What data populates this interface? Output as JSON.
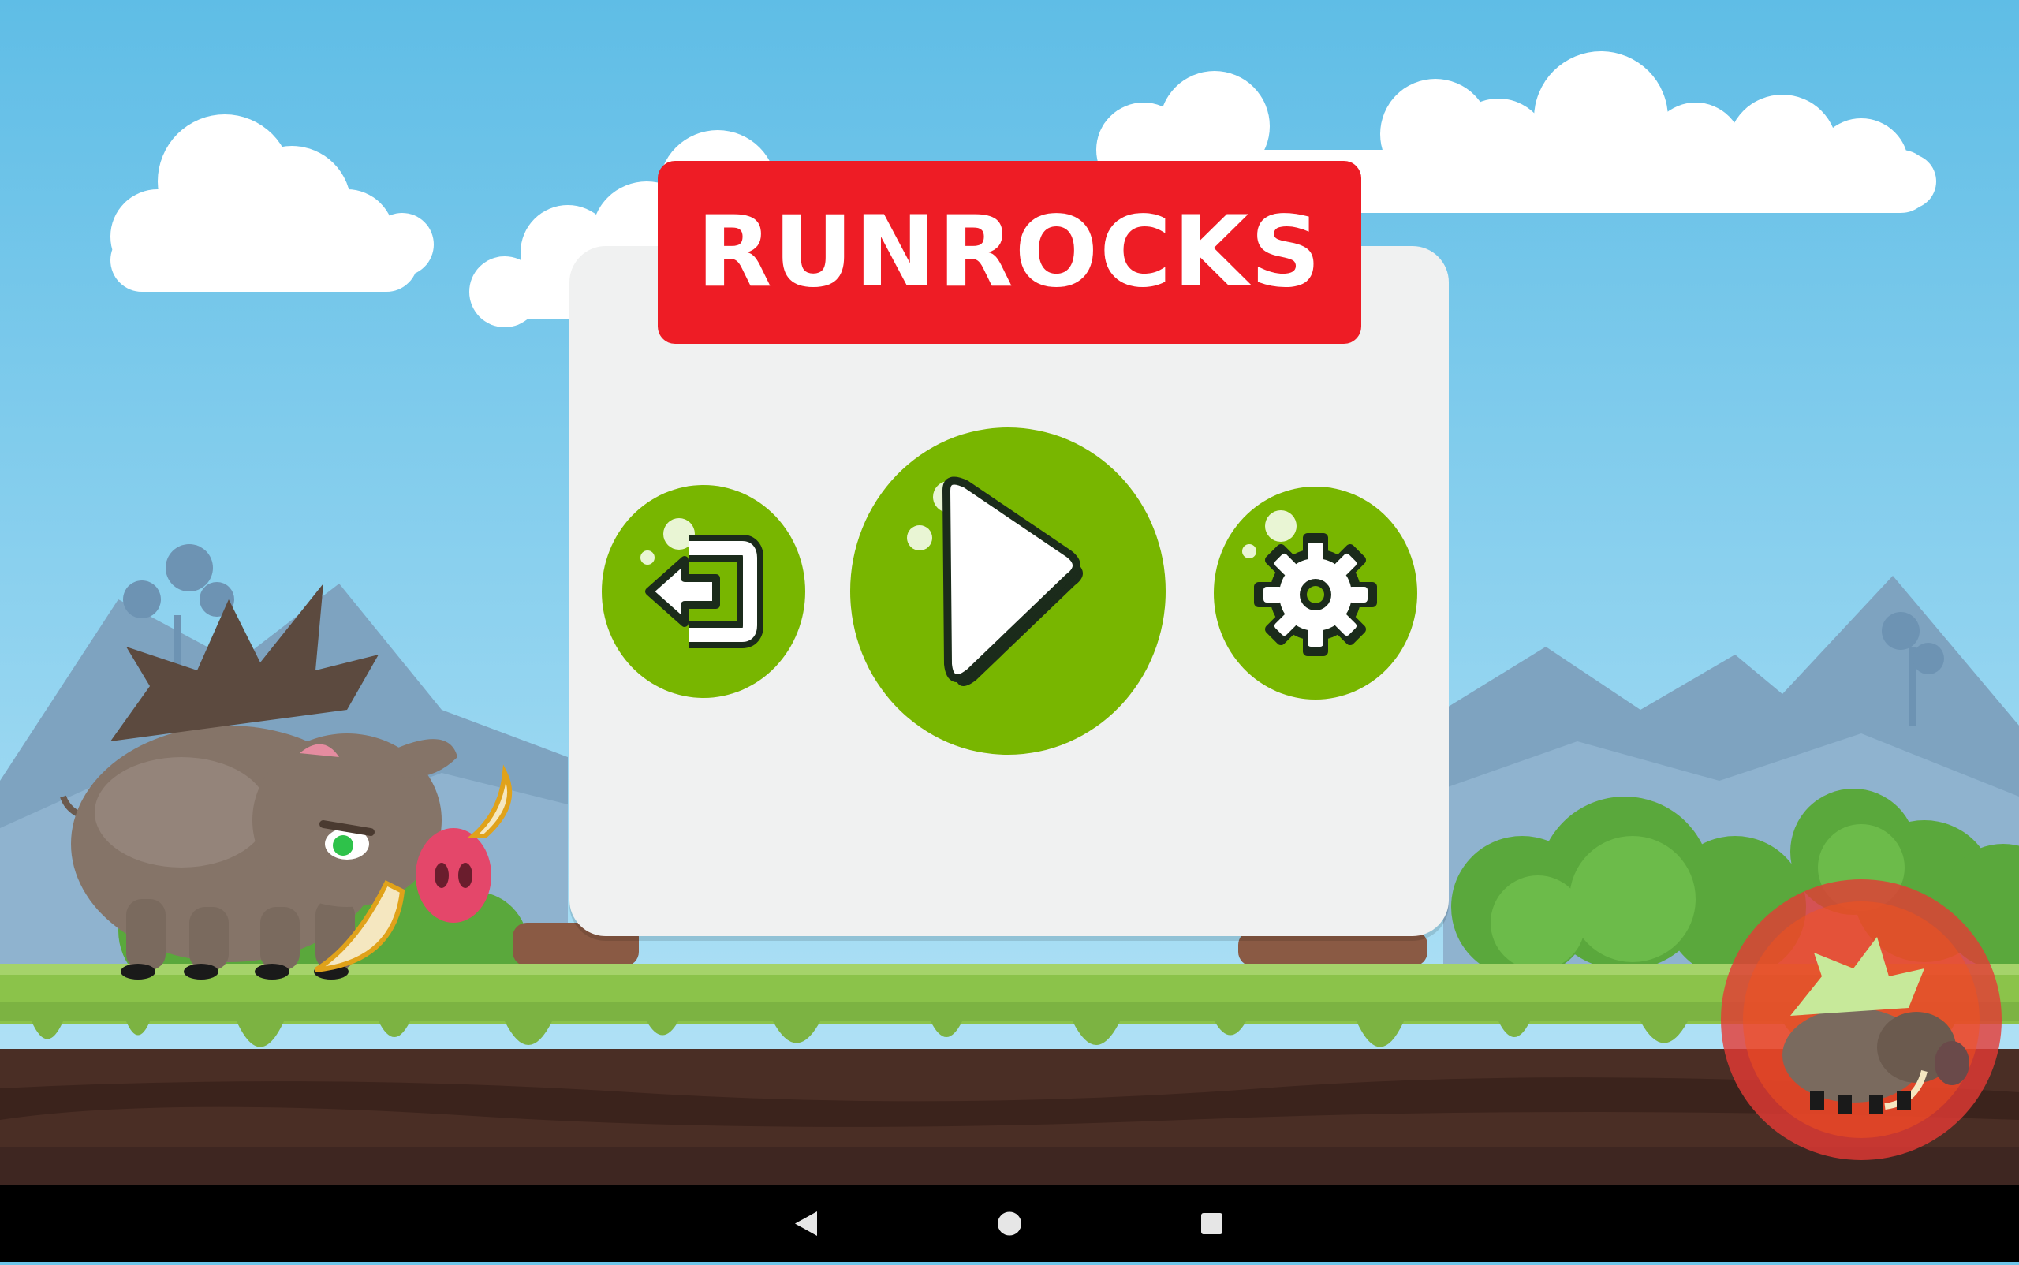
{
  "app": {
    "title": "RUNROCKS"
  },
  "menu": {
    "buttons": [
      {
        "id": "exit",
        "icon": "exit-arrow-icon"
      },
      {
        "id": "play",
        "icon": "play-icon"
      },
      {
        "id": "settings",
        "icon": "gear-icon"
      }
    ]
  },
  "scene": {
    "character": "boar",
    "badge": "boar-badge-icon"
  },
  "colors": {
    "sky": "#6ec6ea",
    "title_banner": "#ee1c25",
    "panel": "#f0f1f1",
    "button_green": "#78b600",
    "grass": "#8bc34a",
    "soil": "#4a2e25",
    "badge_red": "#e53935"
  },
  "system_nav": {
    "icons": [
      "back-triangle-icon",
      "home-circle-icon",
      "recents-square-icon"
    ]
  }
}
